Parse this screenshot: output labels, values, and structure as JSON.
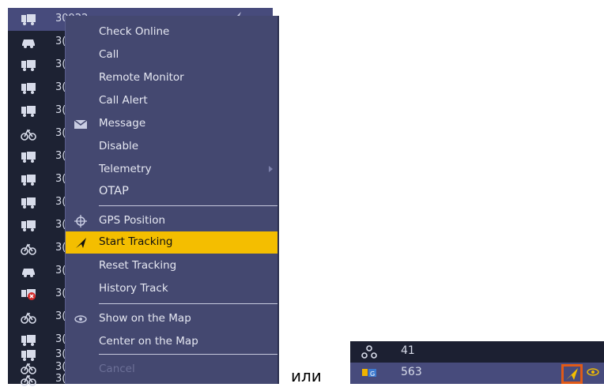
{
  "vehicle_list": {
    "rows": [
      {
        "icon": "truck-icon",
        "number": "30922",
        "selected": true
      },
      {
        "icon": "car-icon",
        "number": "3("
      },
      {
        "icon": "truck-icon",
        "number": "3("
      },
      {
        "icon": "truck-icon",
        "number": "3("
      },
      {
        "icon": "truck-icon",
        "number": "3("
      },
      {
        "icon": "bicycle-icon",
        "number": "3("
      },
      {
        "icon": "truck-icon",
        "number": "3("
      },
      {
        "icon": "truck-icon",
        "number": "3("
      },
      {
        "icon": "truck-icon",
        "number": "3("
      },
      {
        "icon": "truck-icon",
        "number": "3("
      },
      {
        "icon": "bicycle-icon",
        "number": "3("
      },
      {
        "icon": "car-icon",
        "number": "3("
      },
      {
        "icon": "truck-offline-icon",
        "number": "3("
      },
      {
        "icon": "bicycle-icon",
        "number": "3("
      },
      {
        "icon": "truck-icon",
        "number": "3("
      },
      {
        "icon": "truck-icon",
        "number": "3("
      },
      {
        "icon": "bicycle-icon",
        "number": "3("
      },
      {
        "icon": "bicycle-icon",
        "number": "3("
      }
    ]
  },
  "context_menu": {
    "items": [
      {
        "label": "Check Online"
      },
      {
        "label": "Call"
      },
      {
        "label": "Remote Monitor"
      },
      {
        "label": "Call Alert"
      },
      {
        "label": "Message",
        "icon": "envelope-icon"
      },
      {
        "label": "Disable"
      },
      {
        "label": "Telemetry",
        "submenu": true
      },
      {
        "label": "OTAP"
      },
      {
        "label": "GPS Position",
        "icon": "crosshair-icon"
      },
      {
        "label": "Start Tracking",
        "icon": "tracking-icon",
        "active": true
      },
      {
        "label": "Reset Tracking"
      },
      {
        "label": "History Track"
      },
      {
        "label": "Show on the Map",
        "icon": "eye-icon"
      },
      {
        "label": "Center on the Map"
      },
      {
        "label": "Cancel",
        "disabled": true
      }
    ]
  },
  "or_text": "или",
  "mini_panel": {
    "rows": [
      {
        "icon": "group-icon",
        "number": "41"
      },
      {
        "icon": "gps-truck-icon",
        "number": "563",
        "selected": true
      }
    ]
  }
}
